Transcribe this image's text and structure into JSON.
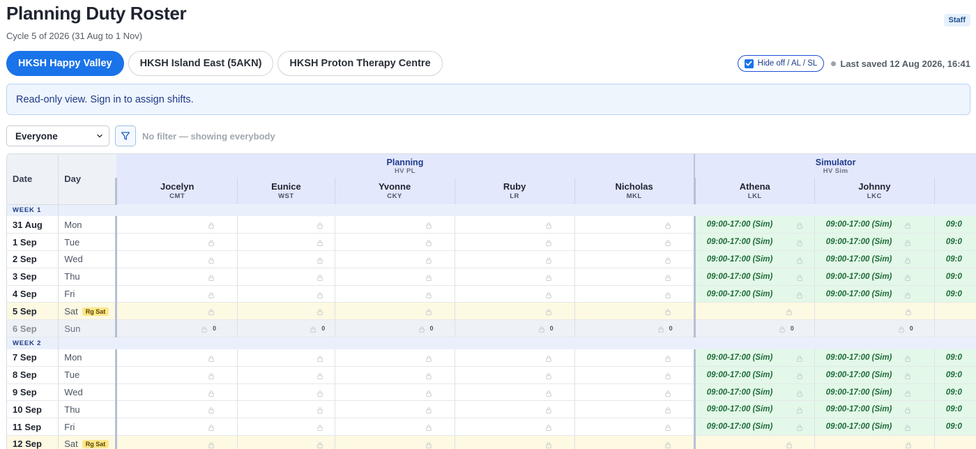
{
  "page": {
    "title": "Planning Duty Roster",
    "subtitle": "Cycle 5 of 2026 (31 Aug to 1 Nov)",
    "staff_badge": "Staff"
  },
  "tabs": [
    {
      "label": "HKSH Happy Valley",
      "active": true
    },
    {
      "label": "HKSH Island East (5AKN)",
      "active": false
    },
    {
      "label": "HKSH Proton Therapy Centre",
      "active": false
    }
  ],
  "toolbar": {
    "hide_toggle_label": "Hide off / AL / SL",
    "hide_toggle_checked": true,
    "last_saved": "Last saved 12 Aug 2026, 16:41"
  },
  "notice": "Read-only view. Sign in to assign shifts.",
  "filter": {
    "select_value": "Everyone",
    "hint": "No filter — showing everybody"
  },
  "grid": {
    "date_header": "Date",
    "day_header": "Day",
    "groups": [
      {
        "name": "Planning",
        "sub": "HV PL"
      },
      {
        "name": "Simulator",
        "sub": "HV Sim"
      }
    ],
    "people": [
      {
        "name": "Jocelyn",
        "code": "CMT",
        "group": "Planning"
      },
      {
        "name": "Eunice",
        "code": "WST",
        "group": "Planning"
      },
      {
        "name": "Yvonne",
        "code": "CKY",
        "group": "Planning"
      },
      {
        "name": "Ruby",
        "code": "LR",
        "group": "Planning"
      },
      {
        "name": "Nicholas",
        "code": "MKL",
        "group": "Planning"
      },
      {
        "name": "Athena",
        "code": "LKL",
        "group": "Simulator"
      },
      {
        "name": "Johnny",
        "code": "LKC",
        "group": "Simulator"
      },
      {
        "name": "",
        "code": "",
        "group": "Simulator"
      }
    ],
    "weekend_badge": "Rg Sat",
    "sim_shift_label": "09:00-17:00 (Sim)",
    "sim_shift_label_clipped": "09:0",
    "sunday_count": "0",
    "weeks": [
      {
        "label": "WEEK 1",
        "days": [
          {
            "date": "31 Aug",
            "day": "Mon",
            "type": "weekday"
          },
          {
            "date": "1 Sep",
            "day": "Tue",
            "type": "weekday"
          },
          {
            "date": "2 Sep",
            "day": "Wed",
            "type": "weekday"
          },
          {
            "date": "3 Sep",
            "day": "Thu",
            "type": "weekday"
          },
          {
            "date": "4 Sep",
            "day": "Fri",
            "type": "weekday"
          },
          {
            "date": "5 Sep",
            "day": "Sat",
            "type": "sat"
          },
          {
            "date": "6 Sep",
            "day": "Sun",
            "type": "sun"
          }
        ]
      },
      {
        "label": "WEEK 2",
        "days": [
          {
            "date": "7 Sep",
            "day": "Mon",
            "type": "weekday"
          },
          {
            "date": "8 Sep",
            "day": "Tue",
            "type": "weekday"
          },
          {
            "date": "9 Sep",
            "day": "Wed",
            "type": "weekday"
          },
          {
            "date": "10 Sep",
            "day": "Thu",
            "type": "weekday"
          },
          {
            "date": "11 Sep",
            "day": "Fri",
            "type": "weekday"
          },
          {
            "date": "12 Sep",
            "day": "Sat",
            "type": "sat"
          }
        ]
      }
    ]
  },
  "colors": {
    "accent": "#1a73e8",
    "sim_cell": "#e3f8e8",
    "saturday_row": "#fdf9e2",
    "rg_badge": "#fde68a"
  }
}
